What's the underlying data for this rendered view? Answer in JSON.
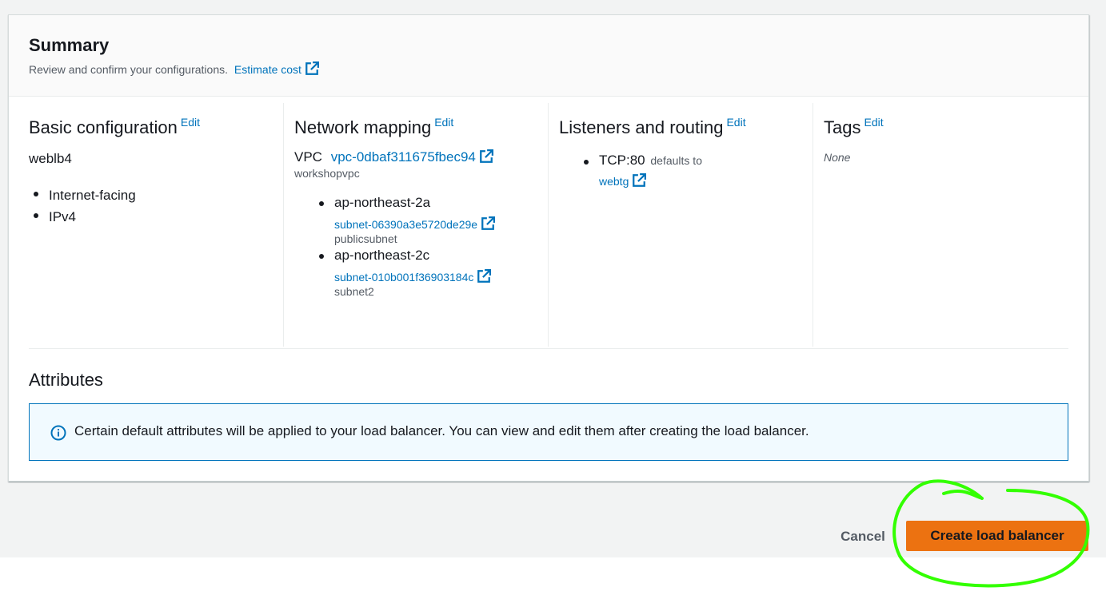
{
  "summary": {
    "title": "Summary",
    "description": "Review and confirm your configurations.",
    "estimate_cost_link": "Estimate cost"
  },
  "basic_configuration": {
    "title": "Basic configuration",
    "edit": "Edit",
    "name": "weblb4",
    "items": [
      "Internet-facing",
      "IPv4"
    ]
  },
  "network_mapping": {
    "title": "Network mapping",
    "edit": "Edit",
    "vpc_label": "VPC",
    "vpc_id": "vpc-0dbaf311675fbec94",
    "vpc_name": "workshopvpc",
    "zones": [
      {
        "zone": "ap-northeast-2a",
        "subnet_id": "subnet-06390a3e5720de29e",
        "subnet_name": "publicsubnet"
      },
      {
        "zone": "ap-northeast-2c",
        "subnet_id": "subnet-010b001f36903184c",
        "subnet_name": "subnet2"
      }
    ]
  },
  "listeners_routing": {
    "title": "Listeners and routing",
    "edit": "Edit",
    "listener": "TCP:80",
    "defaults_to": "defaults to",
    "target_group": "webtg"
  },
  "tags": {
    "title": "Tags",
    "edit": "Edit",
    "value": "None"
  },
  "attributes": {
    "title": "Attributes",
    "info_text": "Certain default attributes will be applied to your load balancer. You can view and edit them after creating the load balancer."
  },
  "actions": {
    "cancel": "Cancel",
    "create": "Create load balancer"
  },
  "colors": {
    "link": "#0073bb",
    "primary_button": "#ec7211",
    "annotation": "#33ff00"
  }
}
